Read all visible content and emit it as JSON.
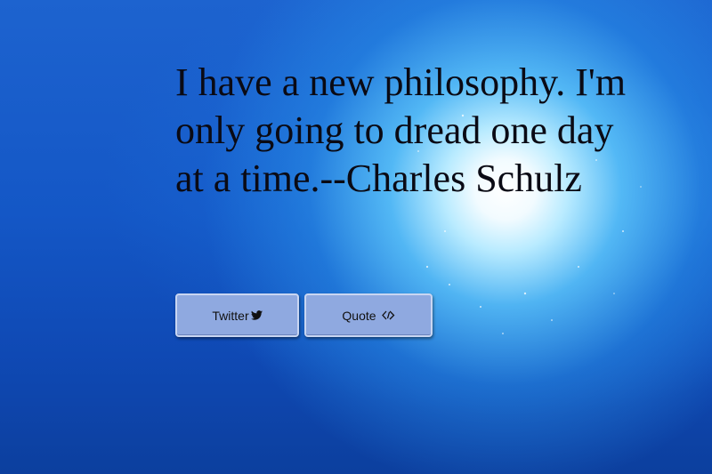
{
  "quote": {
    "text": "I have a new philosophy. I'm only going to dread one day at a time.--Charles Schulz"
  },
  "buttons": {
    "twitter_label": "Twitter",
    "twitter_icon": "twitter-bird-icon",
    "quote_label": "Quote",
    "quote_icon": "code-chevrons-icon"
  },
  "colors": {
    "background_blue": "#1457c6",
    "glow_center": "#ffffff",
    "button_fill": "#8fa9e0",
    "text": "#0a0a14"
  }
}
